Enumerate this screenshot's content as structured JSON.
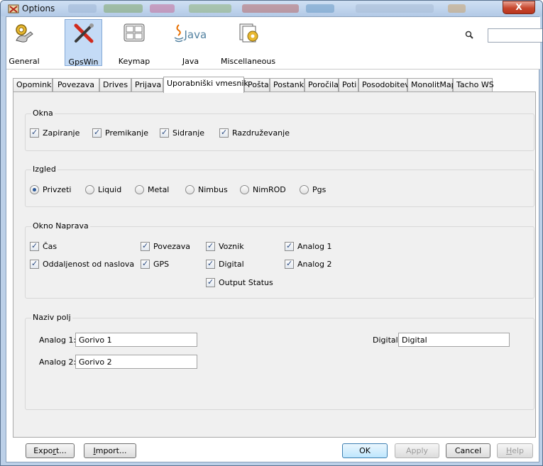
{
  "window": {
    "title": "Options",
    "close_glyph": "X"
  },
  "toolbar": {
    "items": [
      {
        "label": "General",
        "icon": "gears-icon"
      },
      {
        "label": "GpsWin",
        "icon": "tools-icon",
        "selected": true
      },
      {
        "label": "Keymap",
        "icon": "keyboard-icon"
      },
      {
        "label": "Java",
        "icon": "java-icon",
        "icon_text": "Java"
      },
      {
        "label": "Miscellaneous",
        "icon": "misc-icon"
      }
    ],
    "search_icon": "search-icon",
    "search_value": ""
  },
  "tabs": [
    {
      "label": "Opomink"
    },
    {
      "label": "Povezava"
    },
    {
      "label": "Drives"
    },
    {
      "label": "Prijava"
    },
    {
      "label": "Uporabniški vmesnik",
      "active": true
    },
    {
      "label": "Pošta"
    },
    {
      "label": "Postanki"
    },
    {
      "label": "Poročila"
    },
    {
      "label": "Poti"
    },
    {
      "label": "Posodobitev"
    },
    {
      "label": "MonolitMap"
    },
    {
      "label": "Tacho WS"
    }
  ],
  "okna": {
    "title": "Okna",
    "items": [
      {
        "label": "Zapiranje",
        "checked": true
      },
      {
        "label": "Premikanje",
        "checked": true
      },
      {
        "label": "Sidranje",
        "checked": true
      },
      {
        "label": "Razdruževanje",
        "checked": true
      }
    ]
  },
  "izgled": {
    "title": "Izgled",
    "selected": "Privzeti",
    "options": [
      {
        "label": "Privzeti"
      },
      {
        "label": "Liquid"
      },
      {
        "label": "Metal"
      },
      {
        "label": "Nimbus"
      },
      {
        "label": "NimROD"
      },
      {
        "label": "Pgs"
      }
    ]
  },
  "okno_naprava": {
    "title": "Okno Naprava",
    "items": [
      {
        "label": "Čas",
        "checked": true
      },
      {
        "label": "Oddaljenost od naslova",
        "checked": true
      },
      {
        "label": "Povezava",
        "checked": true
      },
      {
        "label": "GPS",
        "checked": true
      },
      {
        "label": "Voznik",
        "checked": true
      },
      {
        "label": "Digital",
        "checked": true
      },
      {
        "label": "Output Status",
        "checked": true
      },
      {
        "label": "Analog 1",
        "checked": true
      },
      {
        "label": "Analog 2",
        "checked": true
      }
    ]
  },
  "naziv_polj": {
    "title": "Naziv polj",
    "analog1": {
      "label": "Analog 1:",
      "value": "Gorivo 1"
    },
    "analog2": {
      "label": "Analog 2:",
      "value": "Gorivo 2"
    },
    "digital": {
      "label": "Digital:",
      "value": "Digital"
    }
  },
  "buttons": {
    "export": {
      "pre": "Expo",
      "mnemonic": "r",
      "post": "t..."
    },
    "import": {
      "pre": "",
      "mnemonic": "I",
      "post": "mport..."
    },
    "ok": "OK",
    "apply": "Apply",
    "cancel": "Cancel",
    "help": {
      "pre": "",
      "mnemonic": "H",
      "post": "elp"
    }
  }
}
